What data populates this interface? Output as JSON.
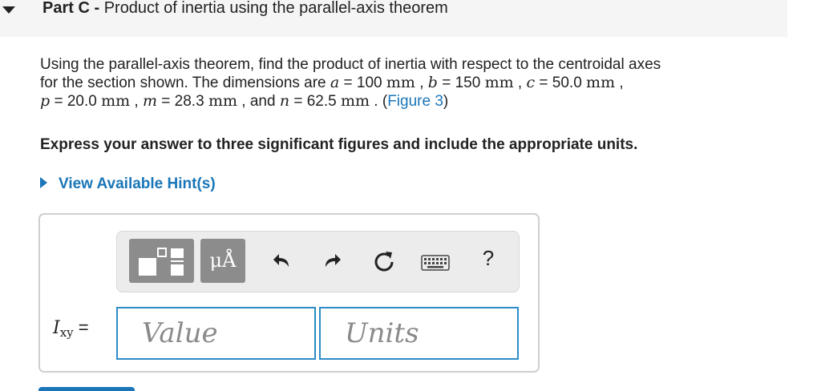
{
  "part": {
    "label": "Part C -",
    "title": "Product of inertia using the parallel-axis theorem"
  },
  "problem": {
    "line1": "Using the parallel-axis theorem, find the product of inertia with respect to the centroidal axes",
    "line2_a": "for the section shown. The dimensions are ",
    "var_a": "a",
    "a_value": " = 100 ",
    "unit_mm": "mm",
    "sep": " , ",
    "var_b": "b",
    "b_value": " = 150 ",
    "var_c": "c",
    "c_value": " = 50.0 ",
    "var_p": "p",
    "p_value": " = 20.0 ",
    "var_m": "m",
    "m_value": " = 28.3 ",
    "and": " , and ",
    "var_n": "n",
    "n_value": " = 62.5 ",
    "period": " . (",
    "figure_link": "Figure 3",
    "close_paren": ")",
    "line2_end": " ,"
  },
  "instruction": "Express your answer to three significant figures and include the appropriate units.",
  "hint_link": "View Available Hint(s)",
  "toolbar": {
    "templates_icon": "templates-icon",
    "units_button": "μÅ",
    "undo_icon": "undo-icon",
    "redo_icon": "redo-icon",
    "reset_icon": "reset-icon",
    "keyboard_icon": "keyboard-icon",
    "help_button": "?"
  },
  "answer": {
    "variable": "I",
    "variable_sub": "xy",
    "equals": " =",
    "value_placeholder": "Value",
    "units_placeholder": "Units"
  },
  "colors": {
    "link": "#1a76b8",
    "input_border": "#2c8cc7",
    "header_bg": "#f5f5f5",
    "toolbar_bg": "#ececec",
    "dark_button": "#8c8c8c"
  }
}
